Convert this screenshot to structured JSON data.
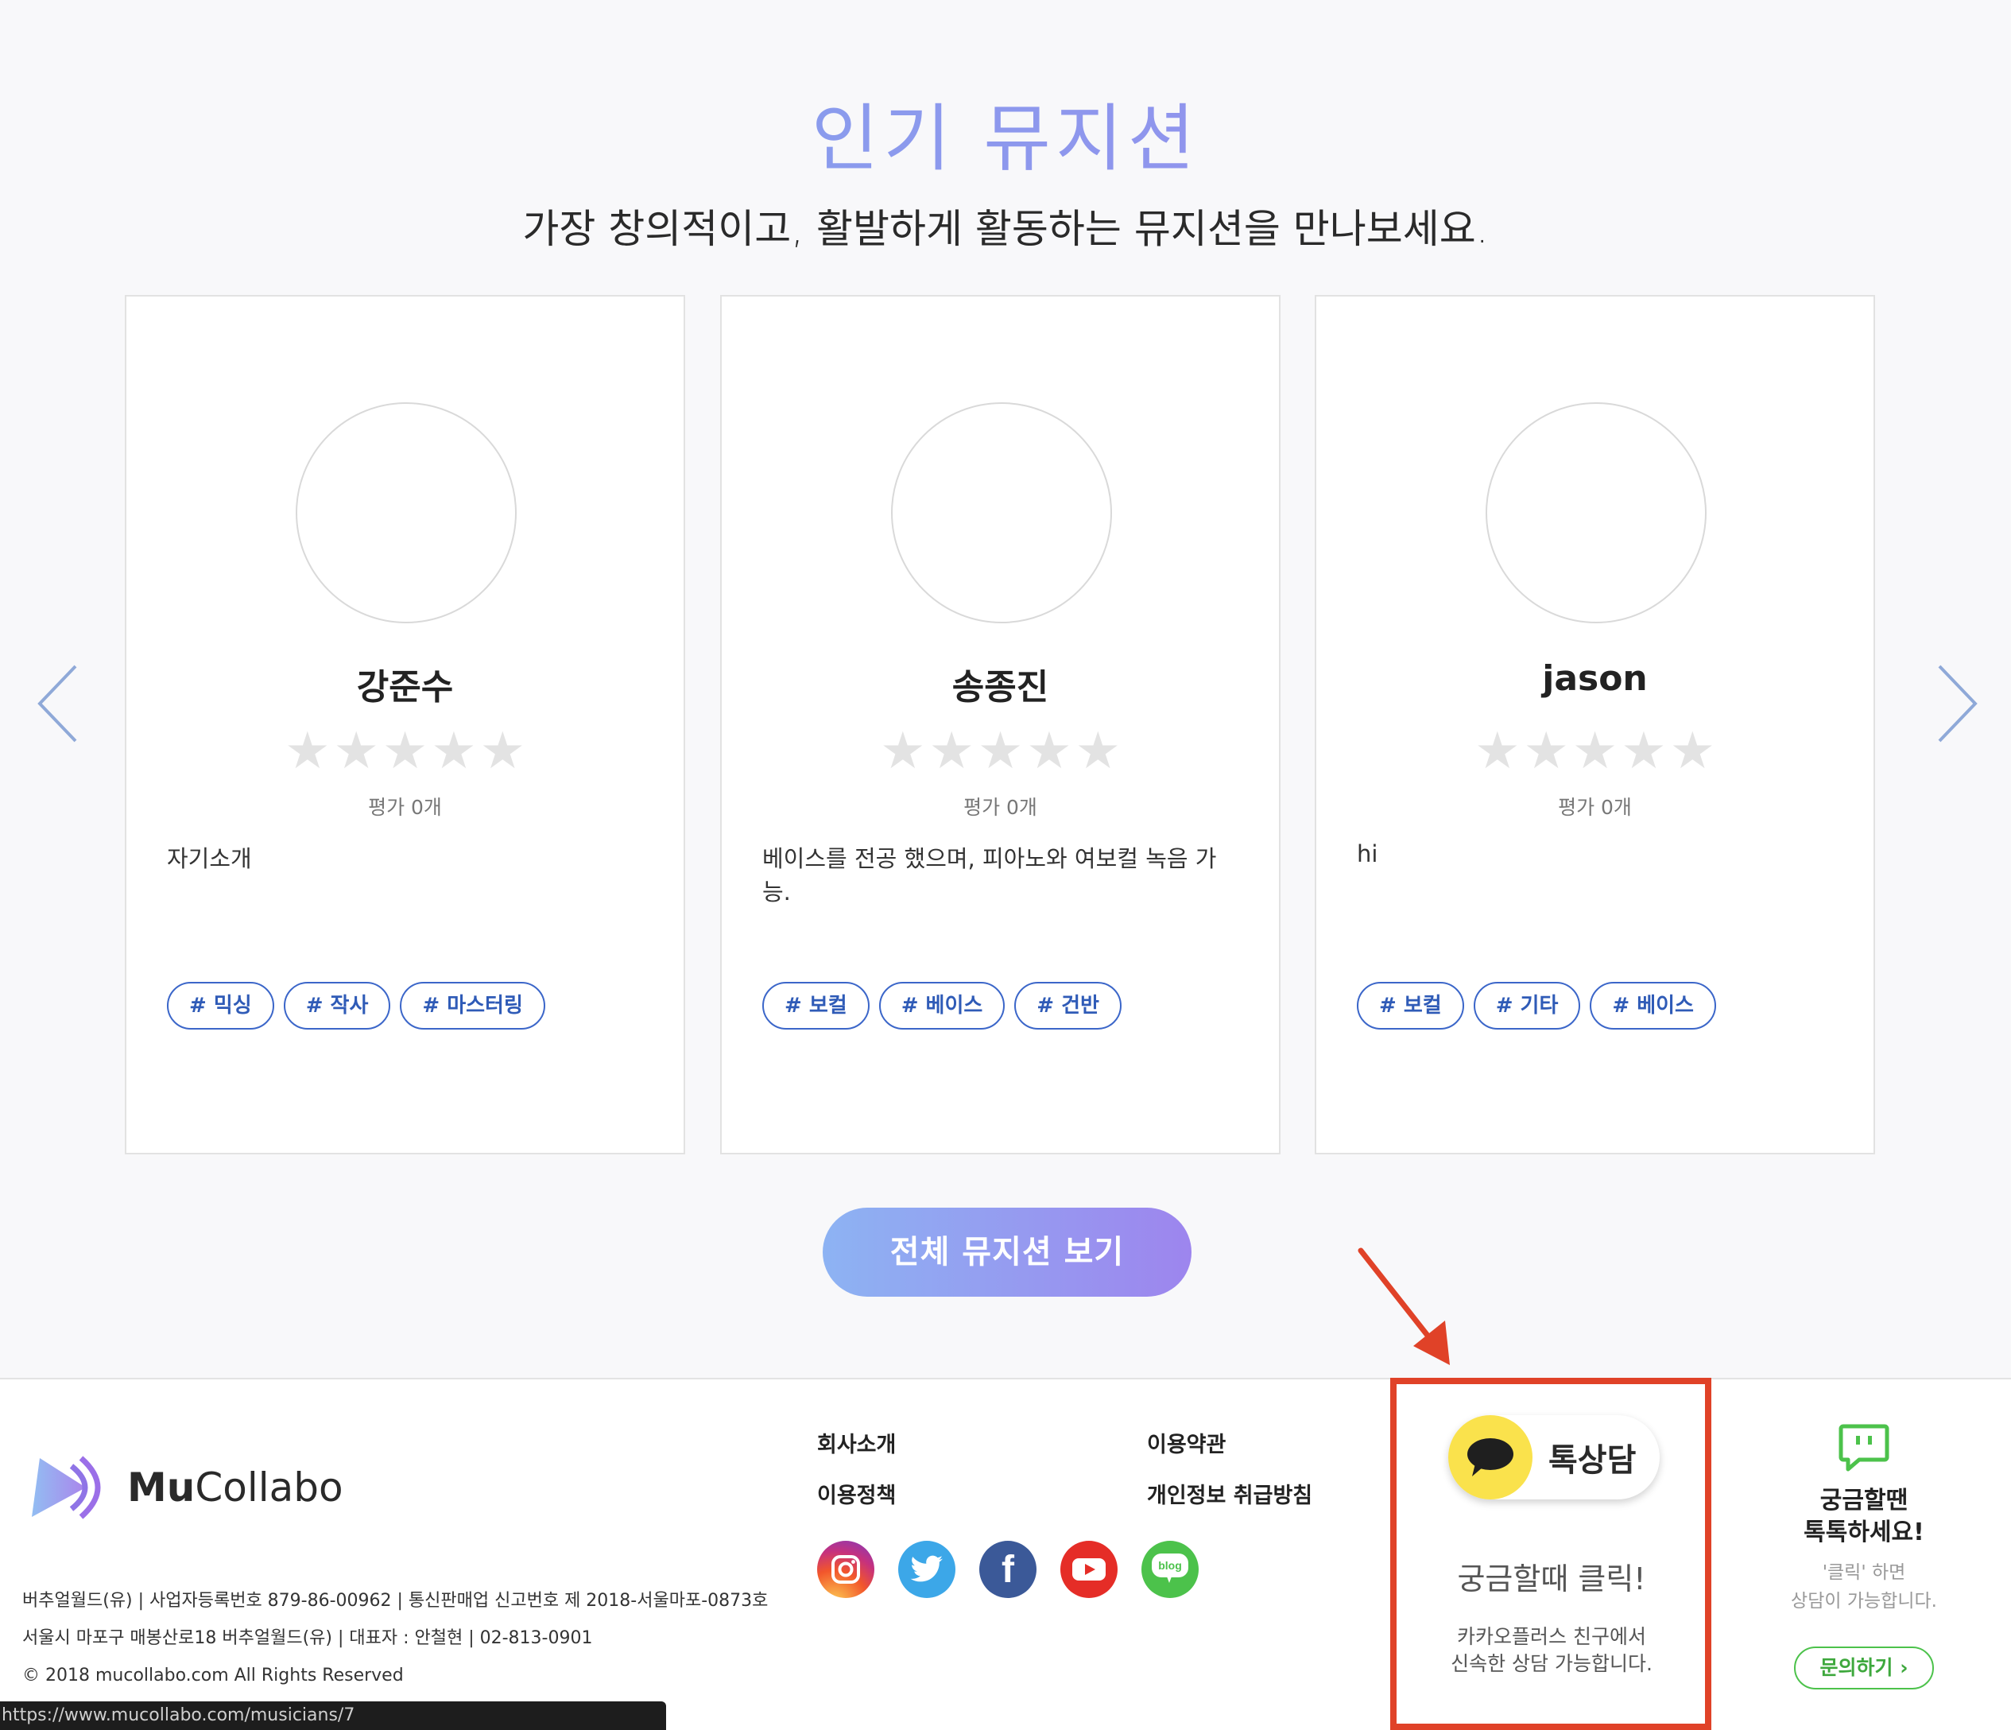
{
  "section": {
    "title": "인기 뮤지션",
    "subtitle": "가장 창의적이고, 활발하게 활동하는 뮤지션을 만나보세요."
  },
  "musicians": [
    {
      "name": "강준수",
      "rating_value": 0,
      "rating_label": "평가 0개",
      "intro": "자기소개",
      "tags": [
        "# 믹싱",
        "# 작사",
        "# 마스터링"
      ]
    },
    {
      "name": "송종진",
      "rating_value": 0,
      "rating_label": "평가 0개",
      "intro": "베이스를 전공 했으며, 피아노와 여보컬 녹음 가능.",
      "tags": [
        "# 보컬",
        "# 베이스",
        "# 건반"
      ]
    },
    {
      "name": "jason",
      "rating_value": 0,
      "rating_label": "평가 0개",
      "intro": "hi",
      "tags": [
        "# 보컬",
        "# 기타",
        "# 베이스"
      ]
    }
  ],
  "view_all_label": "전체 뮤지션 보기",
  "footer": {
    "logo_bold": "Mu",
    "logo_regular": "Collabo",
    "company_lines": [
      "버추얼월드(유) | 사업자등록번호 879-86-00962 | 통신판매업 신고번호 제 2018-서울마포-0873호",
      "서울시 마포구 매봉산로18 버추얼월드(유) | 대표자 : 안철현 | 02-813-0901",
      "© 2018 mucollabo.com All Rights Reserved"
    ],
    "links": {
      "about": "회사소개",
      "terms": "이용약관",
      "policy": "이용정책",
      "privacy": "개인정보 취급방침"
    },
    "social": [
      "instagram-icon",
      "twitter-icon",
      "facebook-icon",
      "youtube-icon",
      "blog-icon"
    ],
    "blog_badge": "blog",
    "facebook_glyph": "f"
  },
  "kakao": {
    "button_label": "톡상담",
    "headline": "궁금할때 클릭!",
    "desc_line1": "카카오플러스 친구에서",
    "desc_line2": "신속한 상담 가능합니다."
  },
  "talk": {
    "title_line1": "궁금할땐",
    "title_line2": "톡톡하세요!",
    "desc_line1": "'클릭' 하면",
    "desc_line2": "상담이 가능합니다.",
    "button_label": "문의하기 ›"
  },
  "status_url": "https://www.mucollabo.com/musicians/7",
  "colors": {
    "title_gradient_start": "#7fa9ee",
    "title_gradient_end": "#9b87ec",
    "tag_blue": "#3b66c9",
    "kakao_yellow": "#fae24c",
    "highlight_red": "#e04228",
    "talk_green": "#4cc24b"
  }
}
